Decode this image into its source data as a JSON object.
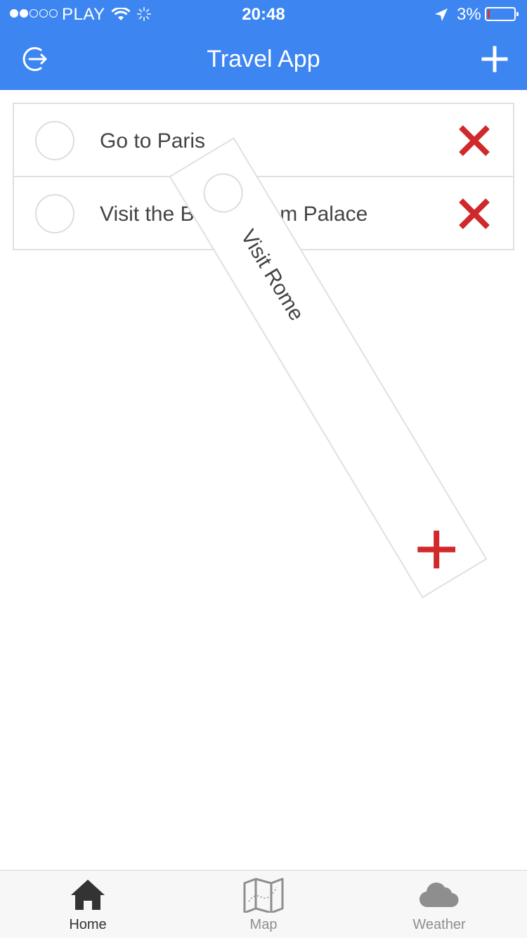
{
  "status_bar": {
    "carrier": "PLAY",
    "time": "20:48",
    "battery_percent": "3%",
    "battery_level": 0.03,
    "signal_bars_filled": 2,
    "signal_bars_total": 5
  },
  "nav": {
    "title": "Travel App",
    "left_icon": "logout-icon",
    "right_icon": "plus-icon"
  },
  "todos": [
    {
      "label": "Go to Paris",
      "done": false
    },
    {
      "label": "Visit the Buchingham Palace",
      "done": false
    }
  ],
  "dragged_todo": {
    "label": "Visit Rome",
    "done": false
  },
  "tabs": [
    {
      "label": "Home",
      "icon": "home-icon",
      "active": true
    },
    {
      "label": "Map",
      "icon": "map-icon",
      "active": false
    },
    {
      "label": "Weather",
      "icon": "cloud-icon",
      "active": false
    }
  ],
  "colors": {
    "header": "#3d86f2",
    "delete": "#d0282b",
    "tab_active": "#333333",
    "tab_inactive": "#8e8e8e"
  }
}
